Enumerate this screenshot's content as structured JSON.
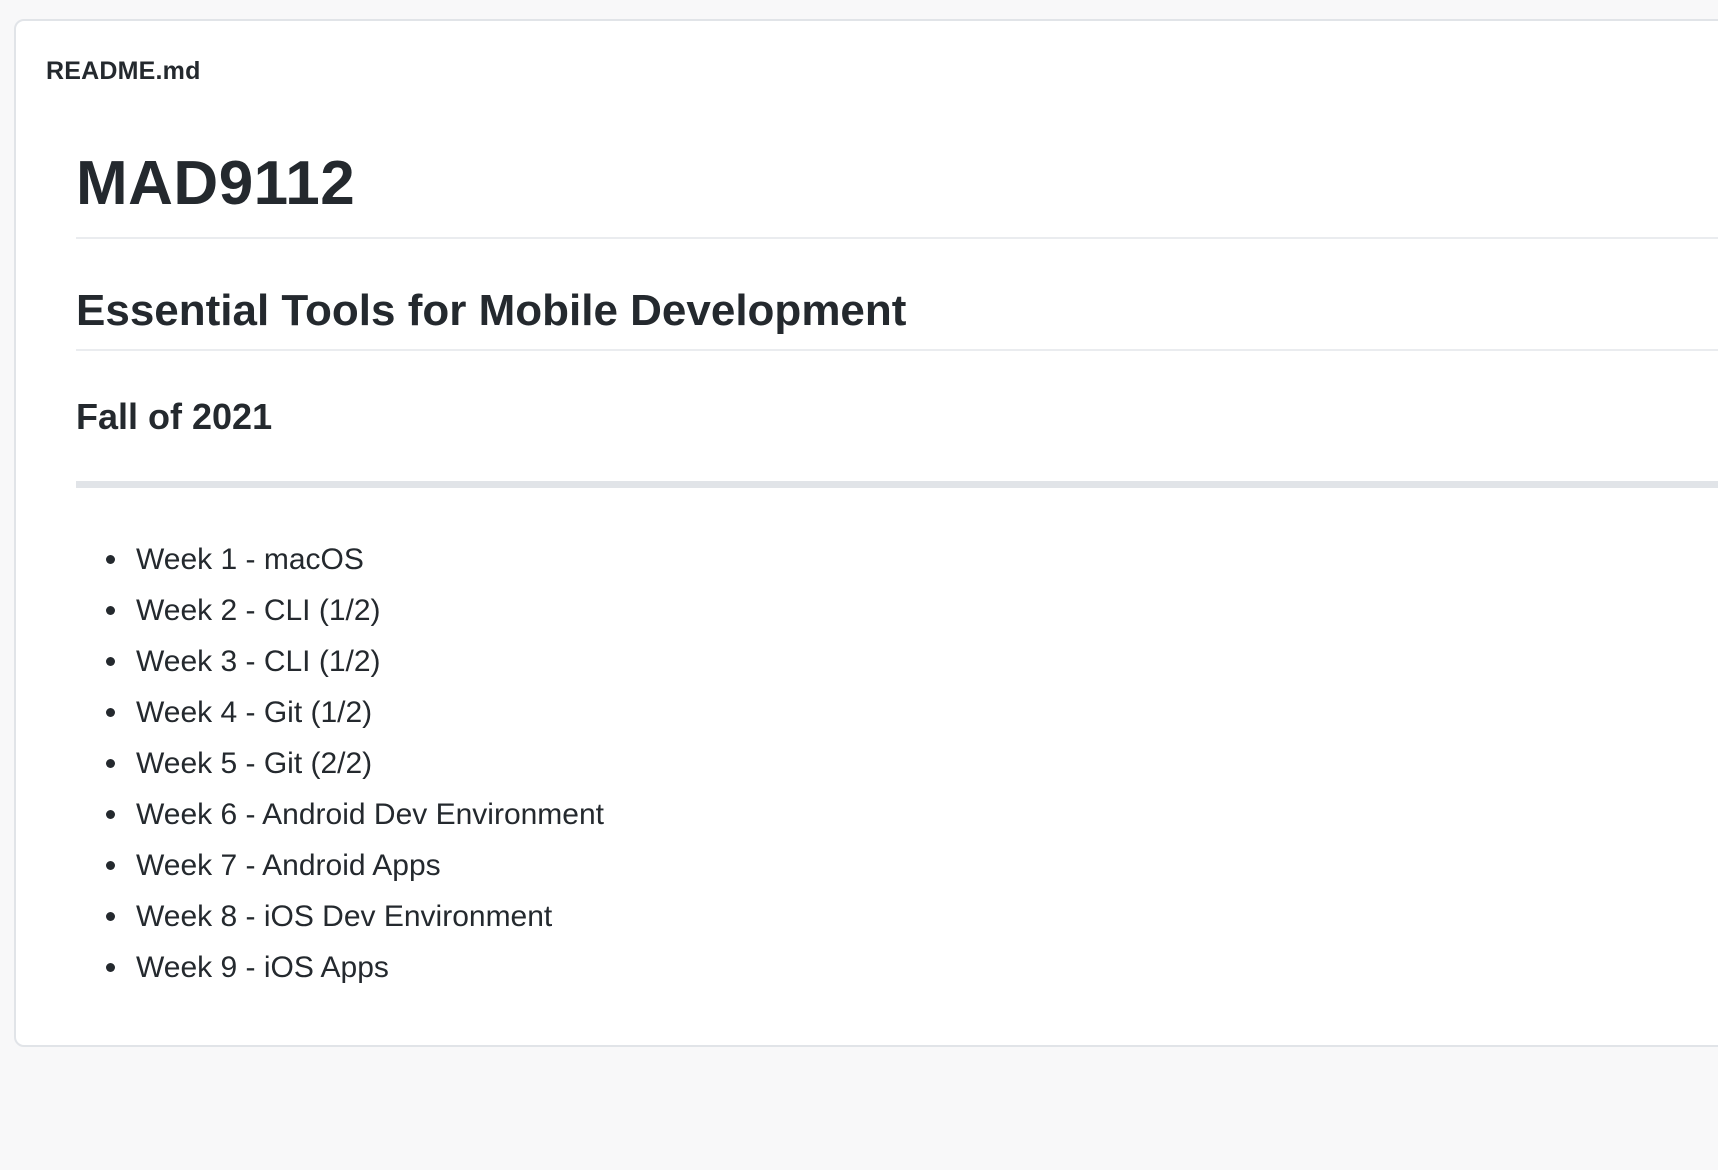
{
  "readme": {
    "filename": "README.md",
    "title": "MAD9112",
    "subtitle": "Essential Tools for Mobile Development",
    "term": "Fall of 2021",
    "weeks": [
      "Week 1 - macOS",
      "Week 2 - CLI (1/2)",
      "Week 3 - CLI (1/2)",
      "Week 4 - Git (1/2)",
      "Week 5 - Git (2/2)",
      "Week 6 - Android Dev Environment",
      "Week 7 - Android Apps",
      "Week 8 - iOS Dev Environment",
      "Week 9 - iOS Apps"
    ]
  },
  "colors": {
    "text": "#24292e",
    "border": "#e1e4e8",
    "divider": "#eaecef",
    "background": "#ffffff"
  }
}
